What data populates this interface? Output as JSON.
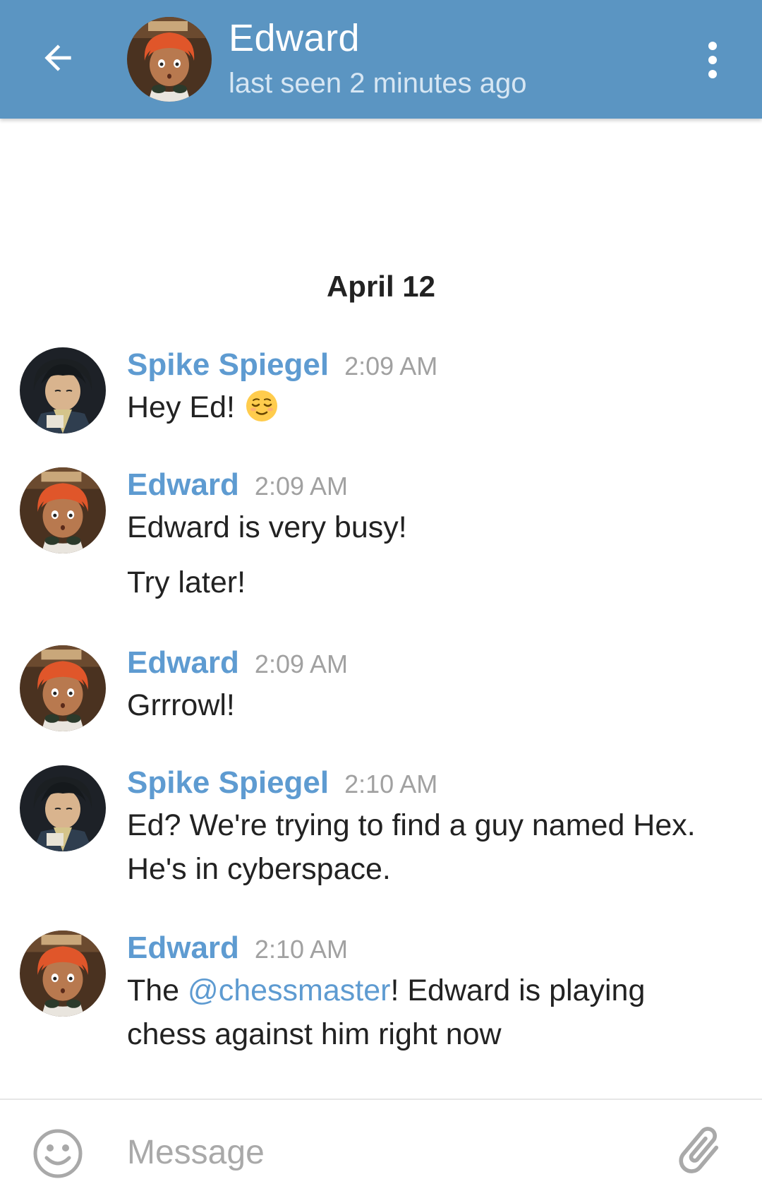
{
  "header": {
    "title": "Edward",
    "status": "last seen 2 minutes ago"
  },
  "date_separator": "April 12",
  "messages": [
    {
      "author": "Spike Spiegel",
      "time": "2:09 AM",
      "lines": [
        "Hey Ed!"
      ],
      "emoji": "relieved-face"
    },
    {
      "author": "Edward",
      "time": "2:09 AM",
      "lines": [
        "Edward is very busy!",
        "Try later!"
      ]
    },
    {
      "author": "Edward",
      "time": "2:09 AM",
      "lines": [
        "Grrrowl!"
      ]
    },
    {
      "author": "Spike Spiegel",
      "time": "2:10 AM",
      "lines": [
        "Ed? We're trying to find a guy named Hex.",
        "He's in cyberspace."
      ]
    },
    {
      "author": "Edward",
      "time": "2:10 AM",
      "text_before": "The ",
      "mention": "@chessmaster",
      "text_after": "! Edward is playing",
      "line2": "chess against him right now"
    }
  ],
  "input": {
    "placeholder": "Message",
    "value": ""
  },
  "icons": {
    "back": "arrow-left-icon",
    "menu": "more-vertical-icon",
    "emoji": "smiley-icon",
    "attach": "paperclip-icon"
  },
  "colors": {
    "header_bg": "#5b95c2",
    "accent": "#5e9bd1",
    "timestamp": "#a1a1a1"
  }
}
